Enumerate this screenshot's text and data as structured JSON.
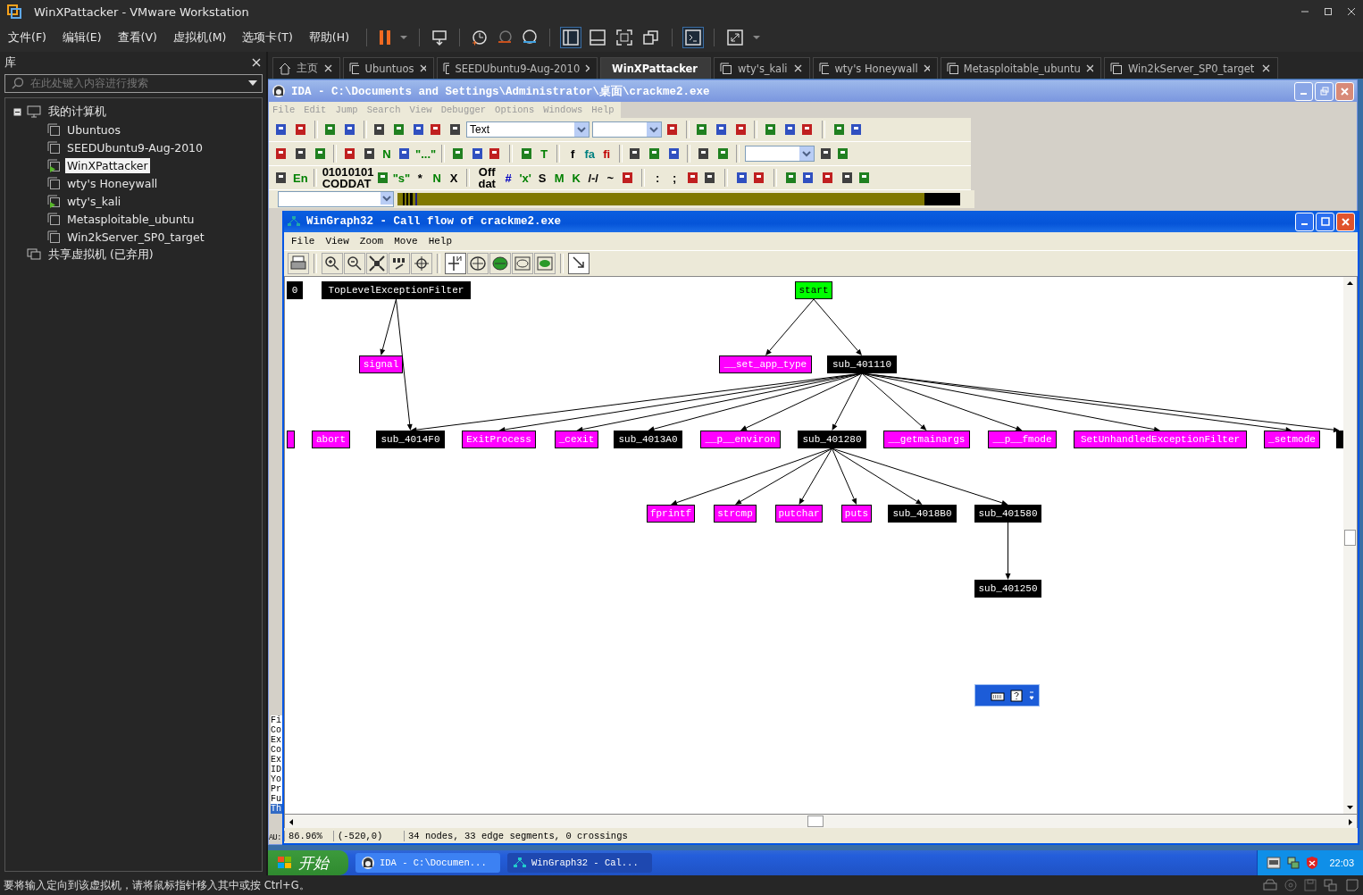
{
  "window": {
    "title": "WinXPattacker - VMware Workstation"
  },
  "menu": [
    "文件(F)",
    "编辑(E)",
    "查看(V)",
    "虚拟机(M)",
    "选项卡(T)",
    "帮助(H)"
  ],
  "library": {
    "title": "库",
    "search_placeholder": "在此处键入内容进行搜索",
    "tree": [
      {
        "label": "我的计算机",
        "kind": "computer",
        "expanded": true,
        "children": [
          {
            "label": "Ubuntuos",
            "running": false,
            "selected": false
          },
          {
            "label": "SEEDUbuntu9-Aug-2010",
            "running": false,
            "selected": false
          },
          {
            "label": "WinXPattacker",
            "running": true,
            "selected": true
          },
          {
            "label": "wty's Honeywall",
            "running": false,
            "selected": false
          },
          {
            "label": "wty's_kali",
            "running": true,
            "selected": false
          },
          {
            "label": "Metasploitable_ubuntu",
            "running": false,
            "selected": false
          },
          {
            "label": "Win2kServer_SP0_target",
            "running": false,
            "selected": false
          }
        ]
      },
      {
        "label": "共享虚拟机 (已弃用)",
        "kind": "shared"
      }
    ]
  },
  "tabs": [
    {
      "label": "主页",
      "kind": "home",
      "selected": false
    },
    {
      "label": "Ubuntuos",
      "kind": "vm",
      "selected": false
    },
    {
      "label": "SEEDUbuntu9-Aug-2010",
      "kind": "vm",
      "selected": false
    },
    {
      "label": "WinXPattacker",
      "kind": "vm",
      "selected": true
    },
    {
      "label": "wty's_kali",
      "kind": "vm",
      "selected": false
    },
    {
      "label": "wty's Honeywall",
      "kind": "vm",
      "selected": false
    },
    {
      "label": "Metasploitable_ubuntu",
      "kind": "vm",
      "selected": false
    },
    {
      "label": "Win2kServer_SP0_target",
      "kind": "vm",
      "selected": false
    }
  ],
  "guest": {
    "ida": {
      "title": "IDA - C:\\Documents and Settings\\Administrator\\桌面\\crackme2.exe",
      "menu": [
        "File",
        "Edit",
        "Jump",
        "Search",
        "View",
        "Debugger",
        "Options",
        "Windows",
        "Help"
      ],
      "toolbar_rows": [
        [
          {
            "kind": "icon"
          },
          {
            "kind": "icon"
          },
          {
            "kind": "sep"
          },
          {
            "kind": "icon"
          },
          {
            "kind": "icon"
          },
          {
            "kind": "sep"
          },
          {
            "kind": "icon"
          },
          {
            "kind": "icon"
          },
          {
            "kind": "icon"
          },
          {
            "kind": "icon"
          },
          {
            "kind": "icon"
          },
          {
            "kind": "combo",
            "value": "Text"
          },
          {
            "kind": "combo"
          },
          {
            "kind": "icon"
          },
          {
            "kind": "sep"
          },
          {
            "kind": "icon"
          },
          {
            "kind": "icon"
          },
          {
            "kind": "icon"
          },
          {
            "kind": "sep"
          },
          {
            "kind": "icon"
          },
          {
            "kind": "icon"
          },
          {
            "kind": "icon"
          },
          {
            "kind": "sep"
          },
          {
            "kind": "icon"
          },
          {
            "kind": "icon"
          }
        ],
        [
          {
            "kind": "icon"
          },
          {
            "kind": "icon"
          },
          {
            "kind": "icon"
          },
          {
            "kind": "sep"
          },
          {
            "kind": "icon"
          },
          {
            "kind": "icon"
          },
          {
            "kind": "glyph",
            "text": "N",
            "color": "#008000"
          },
          {
            "kind": "icon"
          },
          {
            "kind": "glyph",
            "text": "\"...\"",
            "color": "#008000"
          },
          {
            "kind": "sep"
          },
          {
            "kind": "icon"
          },
          {
            "kind": "icon"
          },
          {
            "kind": "icon"
          },
          {
            "kind": "sep"
          },
          {
            "kind": "icon"
          },
          {
            "kind": "glyph",
            "text": "T",
            "color": "#008000"
          },
          {
            "kind": "sep"
          },
          {
            "kind": "glyph",
            "text": "f",
            "color": "#000000"
          },
          {
            "kind": "glyph",
            "text": "fa",
            "color": "#008080"
          },
          {
            "kind": "glyph",
            "text": "fi",
            "color": "#c00000"
          },
          {
            "kind": "sep"
          },
          {
            "kind": "icon"
          },
          {
            "kind": "icon"
          },
          {
            "kind": "icon"
          },
          {
            "kind": "sep"
          },
          {
            "kind": "icon"
          },
          {
            "kind": "icon"
          },
          {
            "kind": "sep"
          },
          {
            "kind": "combo"
          },
          {
            "kind": "icon"
          },
          {
            "kind": "icon"
          }
        ],
        [
          {
            "kind": "icon"
          },
          {
            "kind": "glyph",
            "text": "En",
            "color": "#008000"
          },
          {
            "kind": "sep"
          },
          {
            "kind": "glyph",
            "text": "0101 COD",
            "color": "#000000"
          },
          {
            "kind": "glyph",
            "text": "0101 DAT",
            "color": "#000000"
          },
          {
            "kind": "icon"
          },
          {
            "kind": "glyph",
            "text": "\"s\"",
            "color": "#008000"
          },
          {
            "kind": "glyph",
            "text": "*"
          },
          {
            "kind": "glyph",
            "text": "N",
            "color": "#008000"
          },
          {
            "kind": "glyph",
            "text": "X"
          },
          {
            "kind": "sep"
          },
          {
            "kind": "glyph",
            "text": "Off dat",
            "color": "#000000"
          },
          {
            "kind": "glyph",
            "text": "#",
            "color": "#0000c0"
          },
          {
            "kind": "glyph",
            "text": "'x'",
            "color": "#008000"
          },
          {
            "kind": "glyph",
            "text": "S",
            "color": "#000000"
          },
          {
            "kind": "glyph",
            "text": "M",
            "color": "#008000"
          },
          {
            "kind": "glyph",
            "text": "K",
            "color": "#008000"
          },
          {
            "kind": "glyph",
            "text": "/-/",
            "color": "#000000"
          },
          {
            "kind": "glyph",
            "text": "~"
          },
          {
            "kind": "icon"
          },
          {
            "kind": "sep"
          },
          {
            "kind": "glyph",
            "text": ":"
          },
          {
            "kind": "glyph",
            "text": ";"
          },
          {
            "kind": "icon"
          },
          {
            "kind": "icon"
          },
          {
            "kind": "sep"
          },
          {
            "kind": "icon"
          },
          {
            "kind": "icon"
          },
          {
            "kind": "sep"
          },
          {
            "kind": "icon"
          },
          {
            "kind": "icon"
          },
          {
            "kind": "icon"
          },
          {
            "kind": "icon"
          },
          {
            "kind": "icon"
          }
        ]
      ],
      "output_lines": [
        {
          "text": "Fi",
          "selected": false
        },
        {
          "text": "Co",
          "selected": false
        },
        {
          "text": "Ex",
          "selected": false
        },
        {
          "text": "Co",
          "selected": false
        },
        {
          "text": "Ex",
          "selected": false
        },
        {
          "text": "ID",
          "selected": false
        },
        {
          "text": "Yo",
          "selected": false
        },
        {
          "text": "Pr",
          "selected": false
        },
        {
          "text": "Fu",
          "selected": false
        },
        {
          "text": "Th",
          "selected": true
        }
      ],
      "status": "AU:"
    },
    "wingraph": {
      "title": "WinGraph32 - Call flow of crackme2.exe",
      "menu": [
        "File",
        "View",
        "Zoom",
        "Move",
        "Help"
      ],
      "nodes": [
        {
          "label": "0",
          "kind": "function"
        },
        {
          "label": "TopLevelExceptionFilter",
          "kind": "function"
        },
        {
          "label": "start",
          "kind": "entry"
        },
        {
          "label": "signal",
          "kind": "import"
        },
        {
          "label": "__set_app_type",
          "kind": "import"
        },
        {
          "label": "sub_401110",
          "kind": "function"
        },
        {
          "kind": "import"
        },
        {
          "label": "abort",
          "kind": "import"
        },
        {
          "label": "sub_4014F0",
          "kind": "function"
        },
        {
          "label": "ExitProcess",
          "kind": "import"
        },
        {
          "label": "_cexit",
          "kind": "import"
        },
        {
          "label": "sub_4013A0",
          "kind": "function"
        },
        {
          "label": "__p__environ",
          "kind": "import"
        },
        {
          "label": "sub_401280",
          "kind": "function"
        },
        {
          "label": "__getmainargs",
          "kind": "import"
        },
        {
          "label": "__p__fmode",
          "kind": "import"
        },
        {
          "label": "SetUnhandledExceptionFilter",
          "kind": "import"
        },
        {
          "label": "_setmode",
          "kind": "import"
        },
        {
          "kind": "function"
        },
        {
          "label": "fprintf",
          "kind": "import"
        },
        {
          "label": "strcmp",
          "kind": "import"
        },
        {
          "label": "putchar",
          "kind": "import"
        },
        {
          "label": "puts",
          "kind": "import"
        },
        {
          "label": "sub_4018B0",
          "kind": "function"
        },
        {
          "label": "sub_401580",
          "kind": "function"
        },
        {
          "label": "sub_401250",
          "kind": "function"
        }
      ],
      "status": [
        "86.96%",
        "(-520,0)",
        "34 nodes, 33 edge segments, 0 crossings"
      ]
    },
    "taskbar": {
      "start": "开始",
      "tasks": [
        {
          "label": "IDA - C:\\Documen...",
          "kind": "ida",
          "selected": false
        },
        {
          "label": "WinGraph32 - Cal...",
          "kind": "graph",
          "selected": true
        }
      ],
      "clock": "22:03"
    }
  },
  "status_bar": "要将输入定向到该虚拟机，请将鼠标指针移入其中或按 Ctrl+G。"
}
